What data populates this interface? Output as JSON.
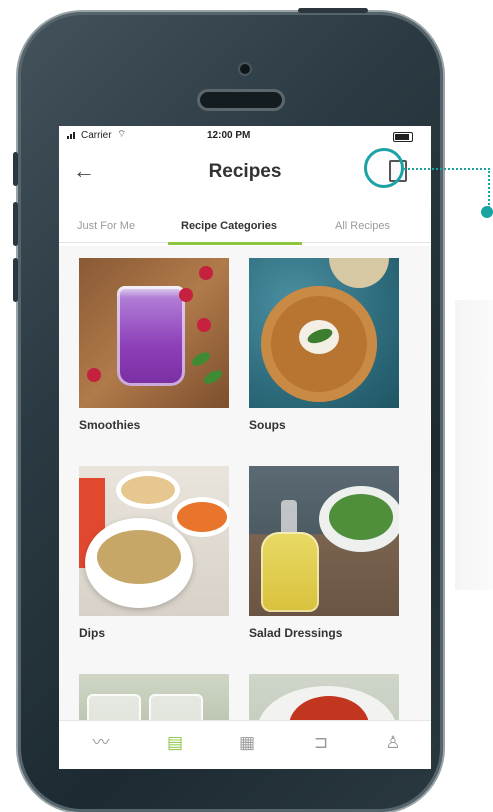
{
  "status_bar": {
    "carrier": "Carrier",
    "time": "12:00 PM"
  },
  "header": {
    "title": "Recipes",
    "back_icon": "arrow-left-icon",
    "action_icon": "device-icon"
  },
  "tabs": [
    {
      "label": "Just For Me",
      "active": false
    },
    {
      "label": "Recipe Categories",
      "active": true
    },
    {
      "label": "All Recipes",
      "active": false
    }
  ],
  "categories": [
    {
      "label": "Smoothies"
    },
    {
      "label": "Soups"
    },
    {
      "label": "Dips"
    },
    {
      "label": "Salad Dressings"
    },
    {
      "label": ""
    },
    {
      "label": ""
    }
  ],
  "tab_bar": [
    {
      "icon": "chart-icon",
      "active": false
    },
    {
      "icon": "recipes-icon",
      "active": true
    },
    {
      "icon": "grocery-icon",
      "active": false
    },
    {
      "icon": "cart-icon",
      "active": false
    },
    {
      "icon": "profile-icon",
      "active": false
    }
  ],
  "colors": {
    "accent": "#8cc63f",
    "callout": "#1aa3a3",
    "phone_body": "#2b3a42"
  }
}
